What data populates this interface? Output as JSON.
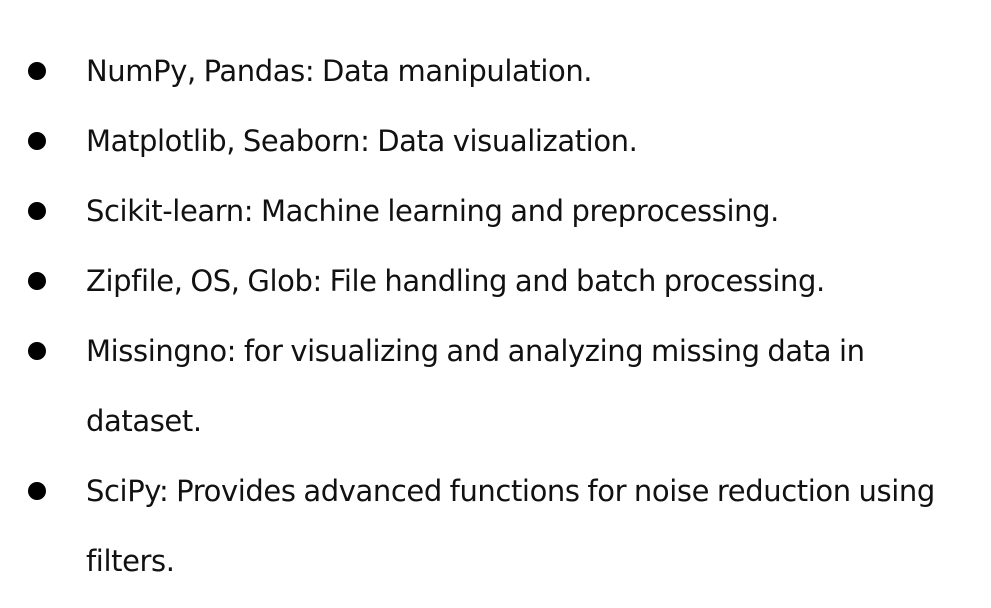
{
  "bullets": [
    {
      "text": "NumPy, Pandas: Data manipulation."
    },
    {
      "text": "Matplotlib, Seaborn: Data visualization."
    },
    {
      "text": "Scikit-learn: Machine learning and preprocessing."
    },
    {
      "text": "Zipfile, OS, Glob: File handling and batch processing."
    },
    {
      "text": "Missingno: for visualizing and analyzing missing data in dataset."
    },
    {
      "text": "SciPy: Provides advanced functions for noise reduction using filters."
    }
  ]
}
